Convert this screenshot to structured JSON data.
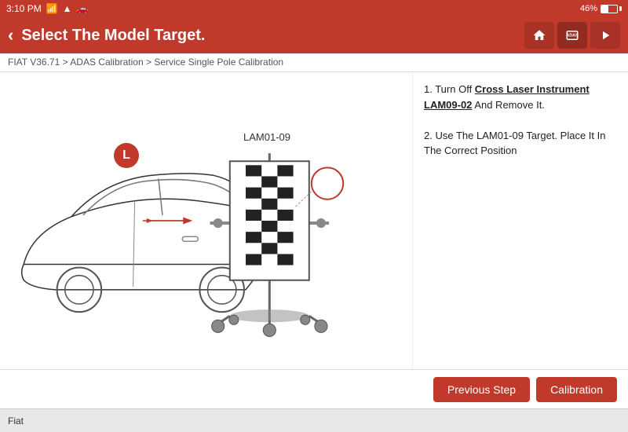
{
  "status_bar": {
    "time": "3:10 PM",
    "battery_percent": "46%"
  },
  "header": {
    "title": "Select The Model Target.",
    "back_label": "‹",
    "icons": {
      "home": "⌂",
      "adas": "ADAS",
      "arrow": "➤"
    }
  },
  "breadcrumb": {
    "text": "FIAT V36.71 > ADAS Calibration > Service Single Pole Calibration"
  },
  "instructions": {
    "line1_prefix": "1. Turn Off ",
    "line1_link": "Cross Laser Instrument LAM09-02",
    "line1_suffix": " And Remove It.",
    "line2": "2. Use The LAM01-09 Target. Place It In The Correct Position"
  },
  "diagram": {
    "lam_label": "LAM01-09"
  },
  "footer_buttons": {
    "previous_step": "Previous Step",
    "calibration": "Calibration"
  },
  "bottom_bar": {
    "brand": "Fiat"
  }
}
